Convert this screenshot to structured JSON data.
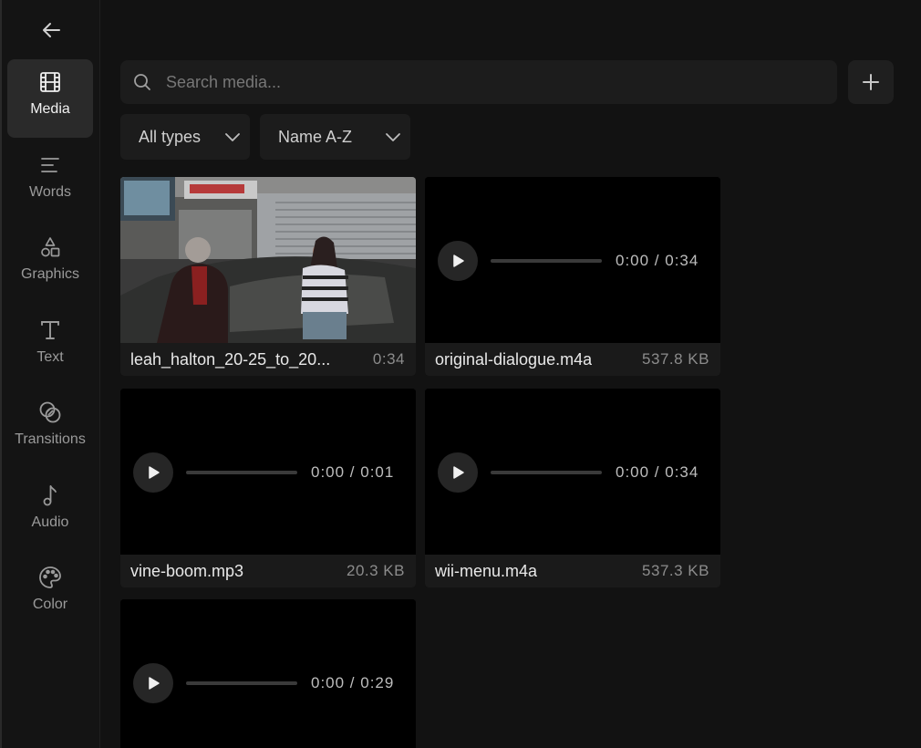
{
  "sidebar": {
    "back_icon": "arrow-left-icon",
    "items": [
      {
        "label": "Media",
        "icon": "film-icon",
        "active": true
      },
      {
        "label": "Words",
        "icon": "lines-icon",
        "active": false
      },
      {
        "label": "Graphics",
        "icon": "shapes-icon",
        "active": false
      },
      {
        "label": "Text",
        "icon": "text-t-icon",
        "active": false
      },
      {
        "label": "Transitions",
        "icon": "overlap-circles-icon",
        "active": false
      },
      {
        "label": "Audio",
        "icon": "music-note-icon",
        "active": false
      },
      {
        "label": "Color",
        "icon": "palette-icon",
        "active": false
      }
    ]
  },
  "search": {
    "placeholder": "Search media...",
    "value": ""
  },
  "toolbar": {
    "add_icon": "plus-icon"
  },
  "filters": {
    "type": "All types",
    "sort": "Name A-Z"
  },
  "media": [
    {
      "type": "video",
      "name": "leah_halton_20-25_to_20...",
      "meta": "0:34"
    },
    {
      "type": "audio",
      "name": "original-dialogue.m4a",
      "meta": "537.8 KB",
      "time": "0:00 / 0:34"
    },
    {
      "type": "audio",
      "name": "vine-boom.mp3",
      "meta": "20.3 KB",
      "time": "0:00 / 0:01"
    },
    {
      "type": "audio",
      "name": "wii-menu.m4a",
      "meta": "537.3 KB",
      "time": "0:00 / 0:34"
    },
    {
      "type": "audio",
      "name": "",
      "meta": "",
      "time": "0:00 / 0:29"
    }
  ],
  "colors": {
    "background": "#121212",
    "panel": "#1c1c1c",
    "active": "#2a2a2a"
  }
}
